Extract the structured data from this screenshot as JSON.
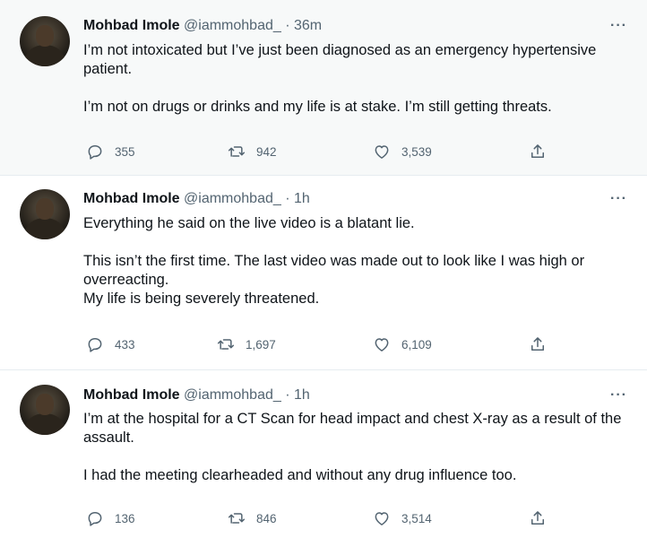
{
  "tweets": [
    {
      "name": "Mohbad Imole",
      "handle": "@iammohbad_",
      "separator": "·",
      "time": "36m",
      "paragraphs": [
        "I’m not intoxicated but I’ve just been diagnosed as an emergency hypertensive patient.",
        "I’m not on drugs or drinks and my life is at stake. I’m still getting threats."
      ],
      "replies": "355",
      "retweets": "942",
      "likes": "3,539"
    },
    {
      "name": "Mohbad Imole",
      "handle": "@iammohbad_",
      "separator": "·",
      "time": "1h",
      "paragraphs": [
        "Everything he said on the live video is a blatant lie.",
        "This isn’t the first time. The last video was made out to look like I was high or overreacting.",
        "My life is being severely threatened."
      ],
      "replies": "433",
      "retweets": "1,697",
      "likes": "6,109"
    },
    {
      "name": "Mohbad Imole",
      "handle": "@iammohbad_",
      "separator": "·",
      "time": "1h",
      "paragraphs": [
        "I’m at the hospital for a CT Scan for head impact and chest X-ray as a result of the assault.",
        "I had the meeting clearheaded and without any drug influence too."
      ],
      "replies": "136",
      "retweets": "846",
      "likes": "3,514"
    }
  ],
  "more_label": "···",
  "colors": {
    "accent": "#1d9bf0",
    "secondary_text": "#536471",
    "first_tweet_bg": "#f7f9f9"
  },
  "icons": [
    "reply-icon",
    "retweet-icon",
    "like-icon",
    "share-icon",
    "more-icon"
  ]
}
